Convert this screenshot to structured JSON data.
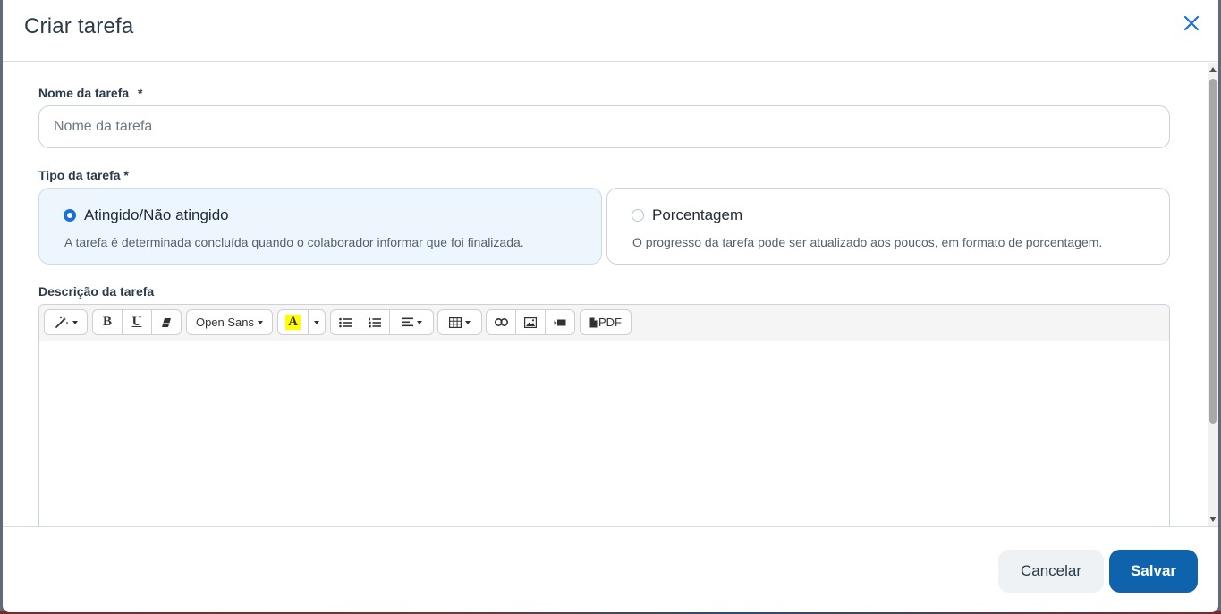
{
  "modal": {
    "title": "Criar tarefa"
  },
  "form": {
    "name_label": "Nome da tarefa",
    "name_required_mark": "*",
    "name_placeholder": "Nome da tarefa",
    "name_value": "",
    "type_label": "Tipo da tarefa *",
    "options": [
      {
        "title": "Atingido/Não atingido",
        "description": "A tarefa é determinada concluída quando o colaborador informar que foi finalizada.",
        "selected": true
      },
      {
        "title": "Porcentagem",
        "description": "O progresso da tarefa pode ser atualizado aos poucos, em formato de porcentagem.",
        "selected": false
      }
    ],
    "description_label": "Descrição da tarefa"
  },
  "toolbar": {
    "font_name": "Open Sans",
    "bold_glyph": "B",
    "underline_glyph": "U",
    "highlight_glyph": "A",
    "highlight_color": "#ffff00",
    "pdf_label": "PDF"
  },
  "footer": {
    "cancel_label": "Cancelar",
    "save_label": "Salvar"
  },
  "colors": {
    "primary": "#0e63ac",
    "close_icon": "#1a6fd8",
    "radio_checked": "#1a6fd8"
  }
}
